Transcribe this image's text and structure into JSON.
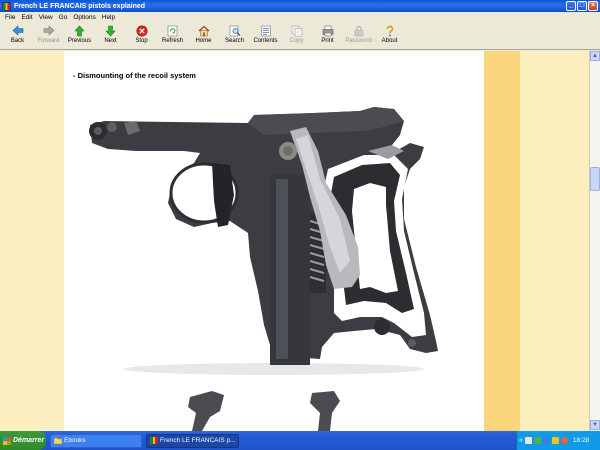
{
  "window": {
    "title": "French LE FRANCAIS pistols explained"
  },
  "menu": [
    "File",
    "Edit",
    "View",
    "Go",
    "Options",
    "Help"
  ],
  "toolbar": [
    {
      "label": "Back",
      "icon": "back-arrow-icon",
      "enabled": true
    },
    {
      "label": "Forward",
      "icon": "forward-arrow-icon",
      "enabled": false
    },
    {
      "label": "Previous",
      "icon": "previous-arrow-icon",
      "enabled": true
    },
    {
      "label": "Next",
      "icon": "next-arrow-icon",
      "enabled": true
    },
    {
      "label": "Stop",
      "icon": "stop-icon",
      "enabled": true
    },
    {
      "label": "Refresh",
      "icon": "refresh-icon",
      "enabled": true
    },
    {
      "label": "Home",
      "icon": "home-icon",
      "enabled": true
    },
    {
      "label": "Search",
      "icon": "search-icon",
      "enabled": true
    },
    {
      "label": "Contents",
      "icon": "contents-icon",
      "enabled": true
    },
    {
      "label": "Copy",
      "icon": "copy-icon",
      "enabled": false
    },
    {
      "label": "Print",
      "icon": "print-icon",
      "enabled": true
    },
    {
      "label": "Password",
      "icon": "password-icon",
      "enabled": false
    },
    {
      "label": "About",
      "icon": "about-icon",
      "enabled": true
    }
  ],
  "content": {
    "heading": "- Dismounting of the recoil system",
    "image": "pistol-frame-photo",
    "colors": {
      "page": "#ffffff",
      "margin": "#fdf0c0",
      "accent_stripe": "#fad57c"
    }
  },
  "taskbar": {
    "start_label": "Démarrer",
    "tasks": [
      {
        "label": "Ebooks",
        "icon": "folder-icon"
      },
      {
        "label": "French LE FRANCAIS p...",
        "icon": "ebook-icon"
      }
    ],
    "chevron": "«",
    "clock": "18:28"
  }
}
